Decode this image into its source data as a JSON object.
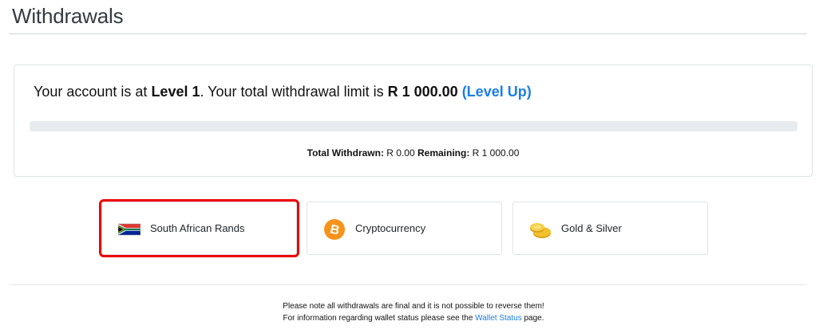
{
  "page": {
    "title": "Withdrawals"
  },
  "limit": {
    "prefix": "Your account is at ",
    "level": "Level 1",
    "middle": ". Your total withdrawal limit is ",
    "amount": "R 1 000.00",
    "level_up_label": "(Level Up)",
    "progress_fraction": 0,
    "withdrawn_label": "Total Withdrawn:",
    "withdrawn_value": " R 0.00 ",
    "remaining_label": "Remaining:",
    "remaining_value": " R 1 000.00"
  },
  "options": [
    {
      "label": "South African Rands",
      "icon": "south-africa-flag-icon",
      "selected": true
    },
    {
      "label": "Cryptocurrency",
      "icon": "bitcoin-icon",
      "selected": false
    },
    {
      "label": "Gold & Silver",
      "icon": "gold-coins-icon",
      "selected": false
    }
  ],
  "notice": {
    "line1": "Please note all withdrawals are final and it is not possible to reverse them!",
    "line2_prefix": "For information regarding wallet status please see the ",
    "link": "Wallet Status",
    "line2_suffix": " page."
  },
  "colors": {
    "accent": "#1a7ee8",
    "selection_outline": "#ee0000",
    "bitcoin": "#f7931a",
    "gold": "#f2c12e"
  }
}
